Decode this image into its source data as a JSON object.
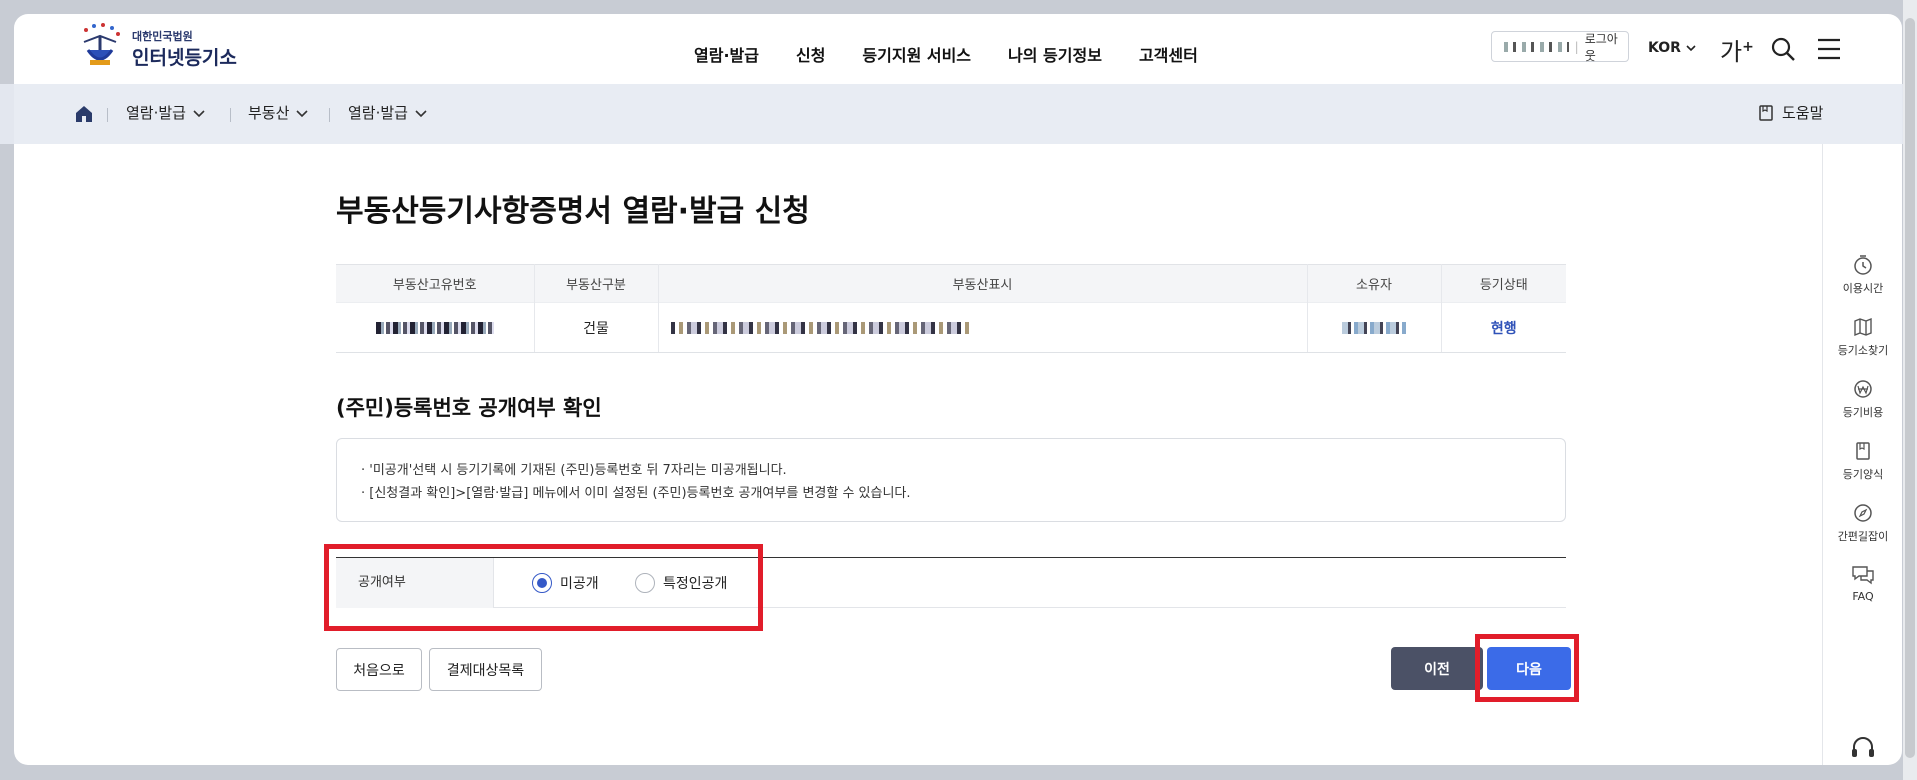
{
  "logo": {
    "small": "대한민국법원",
    "big": "인터넷등기소"
  },
  "gnb": [
    "열람·발급",
    "신청",
    "등기지원 서비스",
    "나의 등기정보",
    "고객센터"
  ],
  "user": {
    "logout": "로그아웃"
  },
  "lang": "KOR",
  "fontsize": {
    "label": "가",
    "plus": "+"
  },
  "breadcrumb": {
    "items": [
      "열람·발급",
      "부동산",
      "열람·발급"
    ],
    "help": "도움말"
  },
  "page": {
    "title": "부동산등기사항증명서 열람·발급 신청"
  },
  "table": {
    "headers": [
      "부동산고유번호",
      "부동산구분",
      "부동산표시",
      "소유자",
      "등기상태"
    ],
    "row": {
      "type": "건물",
      "status": "현행"
    }
  },
  "section": {
    "title": "(주민)등록번호 공개여부 확인"
  },
  "notice": [
    "· '미공개'선택 시 등기기록에 기재된 (주민)등록번호 뒤 7자리는 미공개됩니다.",
    "· [신청결과 확인]>[열람·발급] 메뉴에서 이미 설정된 (주민)등록번호 공개여부를 변경할 수 있습니다."
  ],
  "form": {
    "label": "공개여부",
    "options": [
      "미공개",
      "특정인공개"
    ],
    "selected": "미공개"
  },
  "buttons": {
    "first": "처음으로",
    "payment_list": "결제대상목록",
    "prev": "이전",
    "next": "다음"
  },
  "quick_menu": [
    "이용시간",
    "등기소찾기",
    "등기비용",
    "등기양식",
    "간편길잡이",
    "FAQ"
  ],
  "colors": {
    "accent": "#3b6be8",
    "highlight": "#e11d2a",
    "dark_button": "#4b5166",
    "status": "#2f52b8"
  }
}
